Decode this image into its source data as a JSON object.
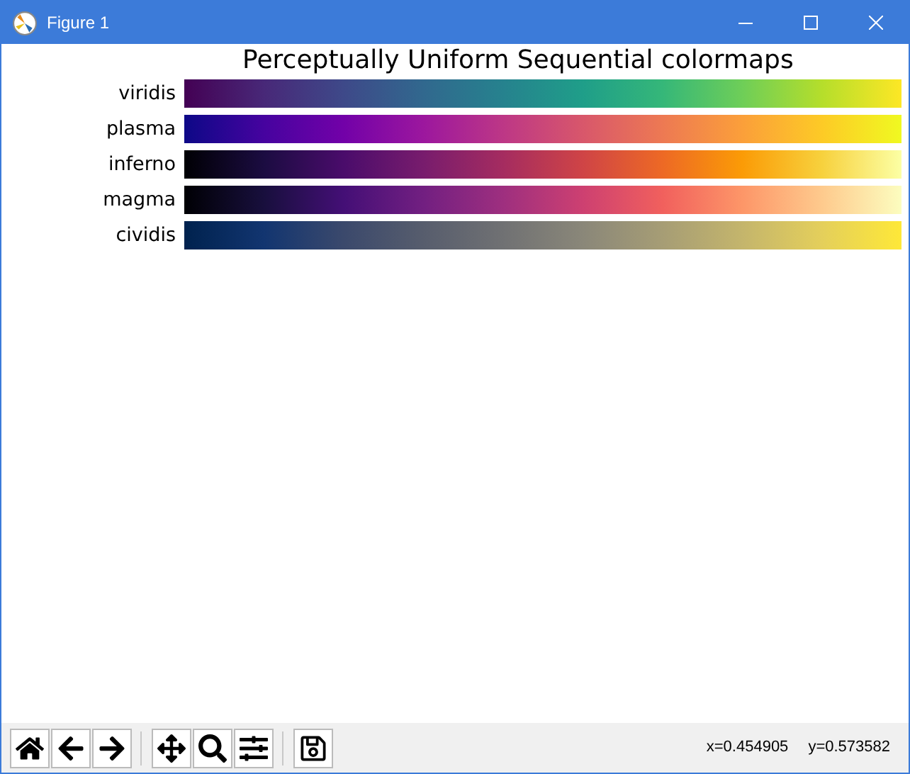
{
  "window": {
    "title": "Figure 1"
  },
  "figure": {
    "title": "Perceptually Uniform Sequential colormaps",
    "colormaps": [
      {
        "name": "viridis",
        "kind": "viridis"
      },
      {
        "name": "plasma",
        "kind": "plasma"
      },
      {
        "name": "inferno",
        "kind": "inferno"
      },
      {
        "name": "magma",
        "kind": "magma"
      },
      {
        "name": "cividis",
        "kind": "cividis"
      }
    ]
  },
  "status_bar": {
    "coordinates": [
      "x=0.454905",
      "y=0.573582"
    ]
  }
}
